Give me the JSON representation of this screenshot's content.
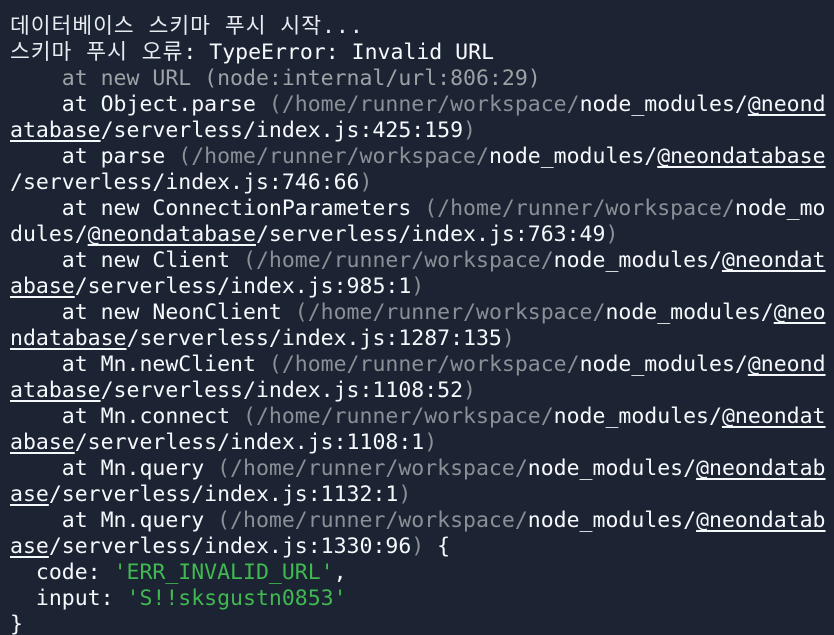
{
  "terminal": {
    "lines": [
      [
        {
          "t": "데이터베이스 스키마 푸시 시작...",
          "c": "hdr"
        }
      ],
      [
        {
          "t": "스키마 푸시 오류",
          "c": "hdr"
        },
        {
          "t": ": TypeError: Invalid URL",
          "c": "mod"
        }
      ],
      [
        {
          "t": "    at new URL (node:internal/url:806:29)",
          "c": "dim"
        }
      ],
      [
        {
          "t": "    at Object.parse ",
          "c": "mod"
        },
        {
          "t": "(/home/runner/workspace/",
          "c": "path"
        },
        {
          "t": "node_modules/",
          "c": "mod"
        },
        {
          "t": "@neond",
          "c": "mod ul"
        }
      ],
      [
        {
          "t": "atabase",
          "c": "mod ul"
        },
        {
          "t": "/serverless/index.js:425:159",
          "c": "mod"
        },
        {
          "t": ")",
          "c": "path"
        }
      ],
      [
        {
          "t": "    at parse ",
          "c": "mod"
        },
        {
          "t": "(/home/runner/workspace/",
          "c": "path"
        },
        {
          "t": "node_modules/",
          "c": "mod"
        },
        {
          "t": "@neondatabase",
          "c": "mod ul"
        }
      ],
      [
        {
          "t": "/serverless/index.js:746:66",
          "c": "mod"
        },
        {
          "t": ")",
          "c": "path"
        }
      ],
      [
        {
          "t": "    at new ConnectionParameters ",
          "c": "mod"
        },
        {
          "t": "(/home/runner/workspace/",
          "c": "path"
        },
        {
          "t": "node_mo",
          "c": "mod"
        }
      ],
      [
        {
          "t": "dules/",
          "c": "mod"
        },
        {
          "t": "@neondatabase",
          "c": "mod ul"
        },
        {
          "t": "/serverless/index.js:763:49",
          "c": "mod"
        },
        {
          "t": ")",
          "c": "path"
        }
      ],
      [
        {
          "t": "    at new Client ",
          "c": "mod"
        },
        {
          "t": "(/home/runner/workspace/",
          "c": "path"
        },
        {
          "t": "node_modules/",
          "c": "mod"
        },
        {
          "t": "@neondat",
          "c": "mod ul"
        }
      ],
      [
        {
          "t": "abase",
          "c": "mod ul"
        },
        {
          "t": "/serverless/index.js:985:1",
          "c": "mod"
        },
        {
          "t": ")",
          "c": "path"
        }
      ],
      [
        {
          "t": "    at new NeonClient ",
          "c": "mod"
        },
        {
          "t": "(/home/runner/workspace/",
          "c": "path"
        },
        {
          "t": "node_modules/",
          "c": "mod"
        },
        {
          "t": "@neo",
          "c": "mod ul"
        }
      ],
      [
        {
          "t": "ndatabase",
          "c": "mod ul"
        },
        {
          "t": "/serverless/index.js:1287:135",
          "c": "mod"
        },
        {
          "t": ")",
          "c": "path"
        }
      ],
      [
        {
          "t": "    at Mn.newClient ",
          "c": "mod"
        },
        {
          "t": "(/home/runner/workspace/",
          "c": "path"
        },
        {
          "t": "node_modules/",
          "c": "mod"
        },
        {
          "t": "@neond",
          "c": "mod ul"
        }
      ],
      [
        {
          "t": "atabase",
          "c": "mod ul"
        },
        {
          "t": "/serverless/index.js:1108:52",
          "c": "mod"
        },
        {
          "t": ")",
          "c": "path"
        }
      ],
      [
        {
          "t": "    at Mn.connect ",
          "c": "mod"
        },
        {
          "t": "(/home/runner/workspace/",
          "c": "path"
        },
        {
          "t": "node_modules/",
          "c": "mod"
        },
        {
          "t": "@neondat",
          "c": "mod ul"
        }
      ],
      [
        {
          "t": "abase",
          "c": "mod ul"
        },
        {
          "t": "/serverless/index.js:1108:1",
          "c": "mod"
        },
        {
          "t": ")",
          "c": "path"
        }
      ],
      [
        {
          "t": "    at Mn.query ",
          "c": "mod"
        },
        {
          "t": "(/home/runner/workspace/",
          "c": "path"
        },
        {
          "t": "node_modules/",
          "c": "mod"
        },
        {
          "t": "@neondatab",
          "c": "mod ul"
        }
      ],
      [
        {
          "t": "ase",
          "c": "mod ul"
        },
        {
          "t": "/serverless/index.js:1132:1",
          "c": "mod"
        },
        {
          "t": ")",
          "c": "path"
        }
      ],
      [
        {
          "t": "    at Mn.query ",
          "c": "mod"
        },
        {
          "t": "(/home/runner/workspace/",
          "c": "path"
        },
        {
          "t": "node_modules/",
          "c": "mod"
        },
        {
          "t": "@neondatab",
          "c": "mod ul"
        }
      ],
      [
        {
          "t": "ase",
          "c": "mod ul"
        },
        {
          "t": "/serverless/index.js:1330:96",
          "c": "mod"
        },
        {
          "t": ")",
          "c": "path"
        },
        {
          "t": " {",
          "c": "mod"
        }
      ],
      [
        {
          "t": "  code: ",
          "c": "mod"
        },
        {
          "t": "'ERR_INVALID_URL'",
          "c": "str"
        },
        {
          "t": ",",
          "c": "mod"
        }
      ],
      [
        {
          "t": "  input: ",
          "c": "mod"
        },
        {
          "t": "'S!!sksgustn0853'",
          "c": "str"
        }
      ],
      [
        {
          "t": "}",
          "c": "mod"
        }
      ]
    ]
  },
  "colors": {
    "background": "#1c2333",
    "text": "#f5f9fc",
    "dim": "#9da2a6",
    "path": "#8b9096",
    "string": "#3fb950"
  }
}
